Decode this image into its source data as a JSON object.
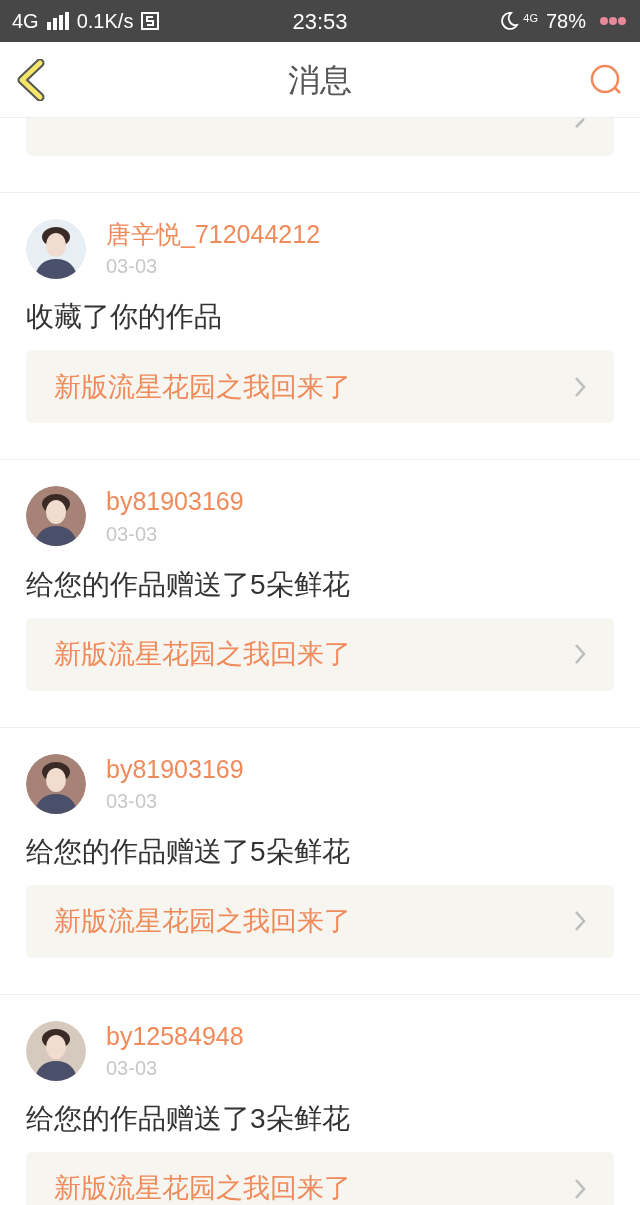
{
  "status_bar": {
    "network": "4G",
    "speed": "0.1K/s",
    "time": "23:53",
    "network_small": "4G",
    "battery": "78%"
  },
  "header": {
    "title": "消息"
  },
  "messages": [
    {
      "user": "唐辛悦_712044212",
      "date": "03-03",
      "text": "收藏了你的作品",
      "link": "新版流星花园之我回来了"
    },
    {
      "user": "by81903169",
      "date": "03-03",
      "text": "给您的作品赠送了5朵鲜花",
      "link": "新版流星花园之我回来了"
    },
    {
      "user": "by81903169",
      "date": "03-03",
      "text": "给您的作品赠送了5朵鲜花",
      "link": "新版流星花园之我回来了"
    },
    {
      "user": "by12584948",
      "date": "03-03",
      "text": "给您的作品赠送了3朵鲜花",
      "link": "新版流星花园之我回来了"
    }
  ]
}
